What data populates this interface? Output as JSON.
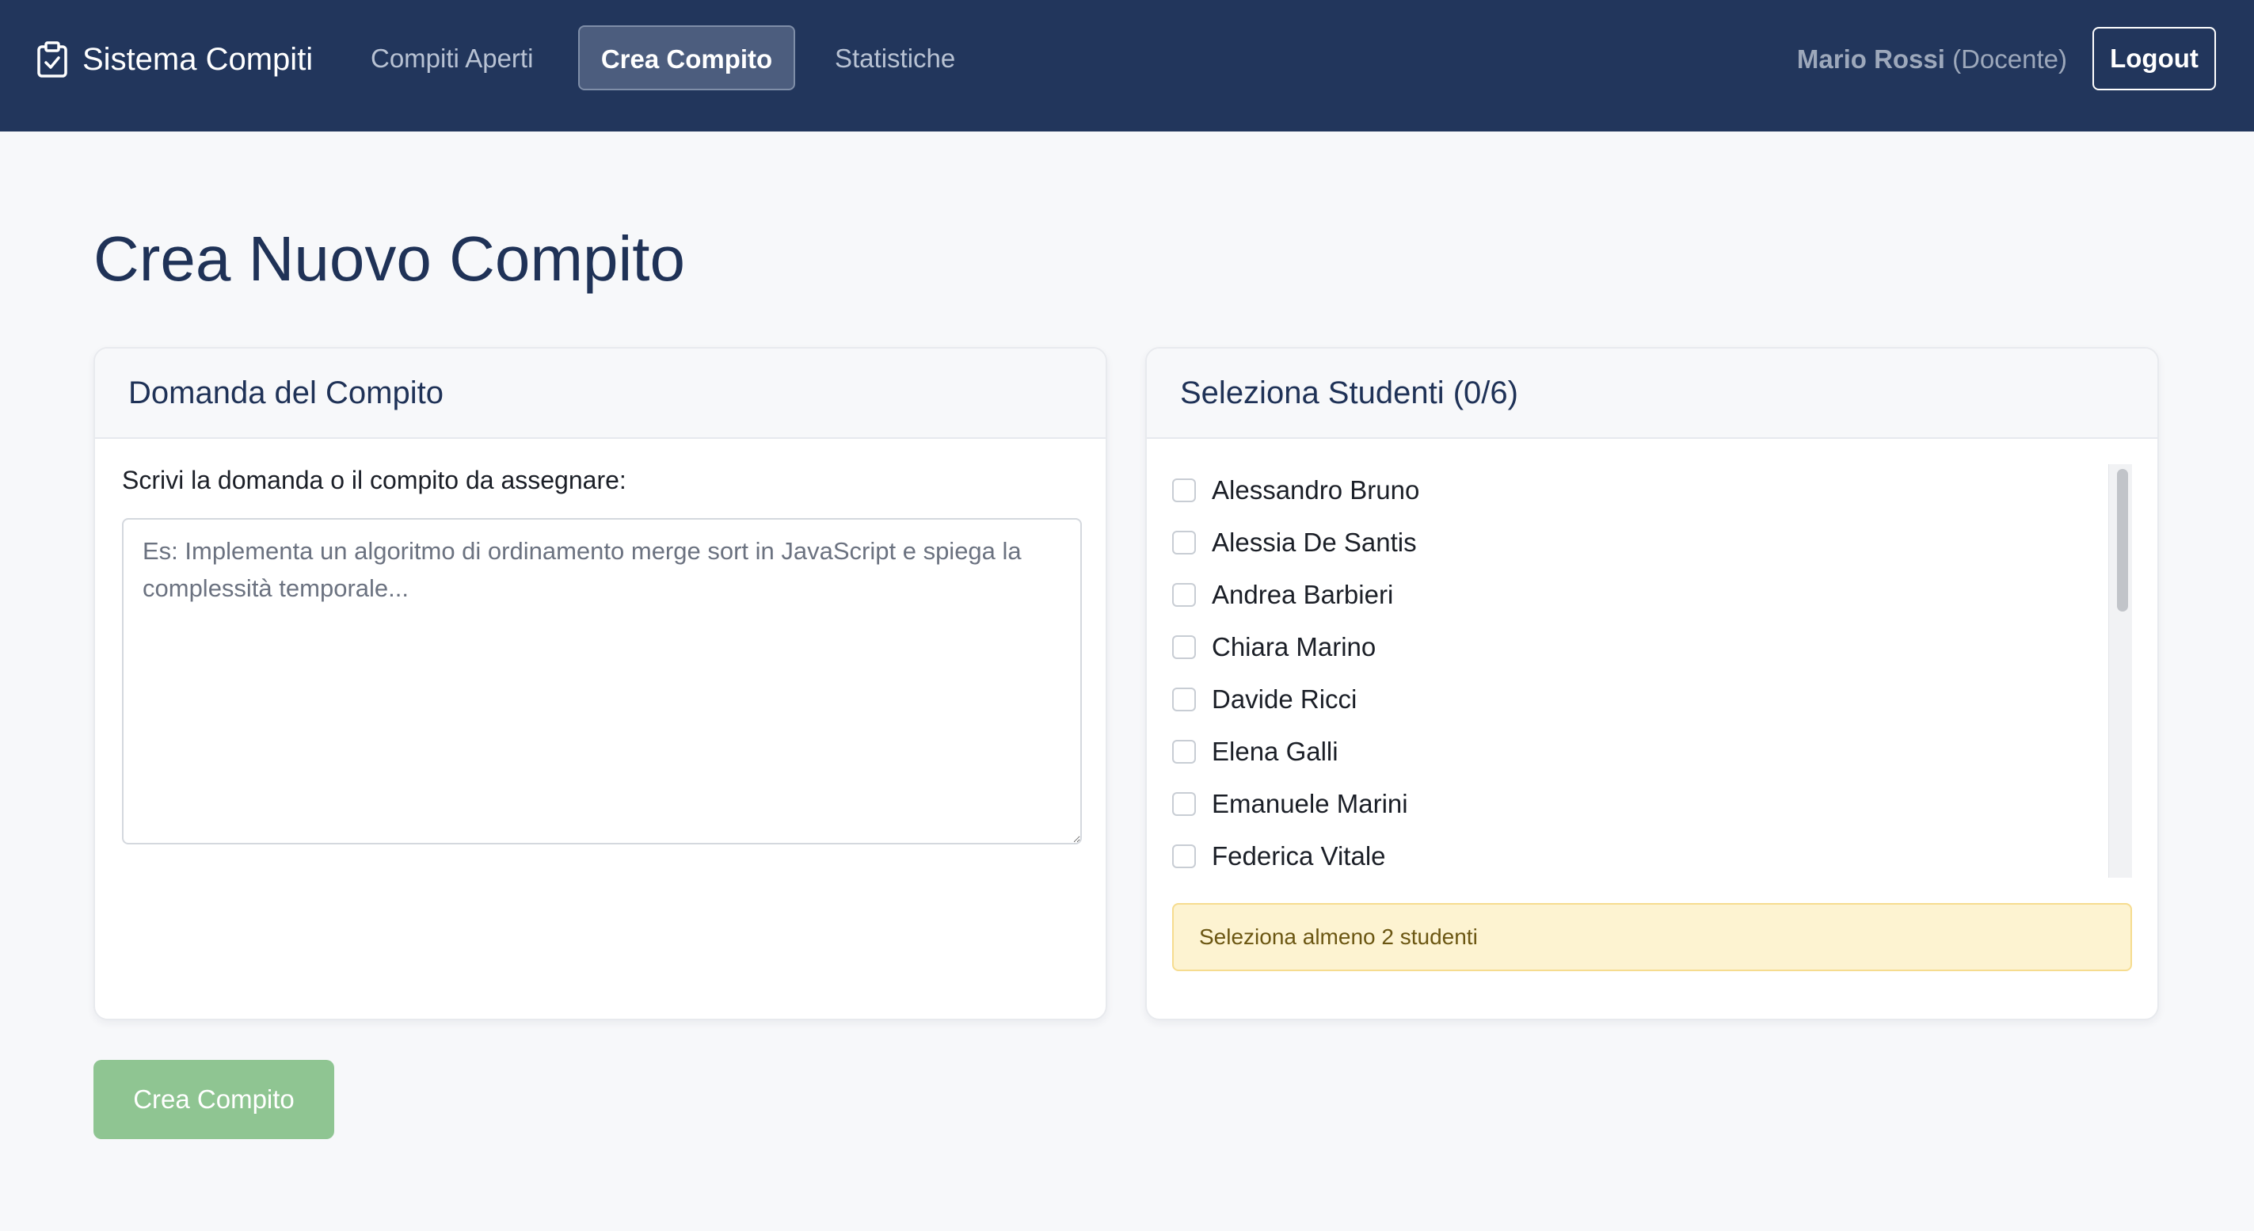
{
  "navbar": {
    "brand": "Sistema Compiti",
    "brand_icon": "clipboard-check-icon",
    "links": [
      {
        "label": "Compiti Aperti",
        "active": false
      },
      {
        "label": "Crea Compito",
        "active": true
      },
      {
        "label": "Statistiche",
        "active": false
      }
    ],
    "user": {
      "name": "Mario Rossi",
      "role": "(Docente)"
    },
    "logout_label": "Logout"
  },
  "page": {
    "title": "Crea Nuovo Compito"
  },
  "question_card": {
    "header": "Domanda del Compito",
    "field_label": "Scrivi la domanda o il compito da assegnare:",
    "textarea_value": "",
    "textarea_placeholder": "Es: Implementa un algoritmo di ordinamento merge sort in JavaScript e spiega la complessità temporale..."
  },
  "students_card": {
    "header": "Seleziona Studenti (0/6)",
    "students": [
      {
        "name": "Alessandro Bruno",
        "checked": false
      },
      {
        "name": "Alessia De Santis",
        "checked": false
      },
      {
        "name": "Andrea Barbieri",
        "checked": false
      },
      {
        "name": "Chiara Marino",
        "checked": false
      },
      {
        "name": "Davide Ricci",
        "checked": false
      },
      {
        "name": "Elena Galli",
        "checked": false
      },
      {
        "name": "Emanuele Marini",
        "checked": false
      },
      {
        "name": "Federica Vitale",
        "checked": false
      }
    ],
    "warning": "Seleziona almeno 2 studenti"
  },
  "actions": {
    "create_label": "Crea Compito",
    "create_enabled": false
  },
  "colors": {
    "navbar": "#22365c",
    "primary_text": "#1f3257",
    "disabled_button": "#8fc592",
    "warning_bg": "#fdf3d1",
    "warning_border": "#f6dc8f"
  }
}
